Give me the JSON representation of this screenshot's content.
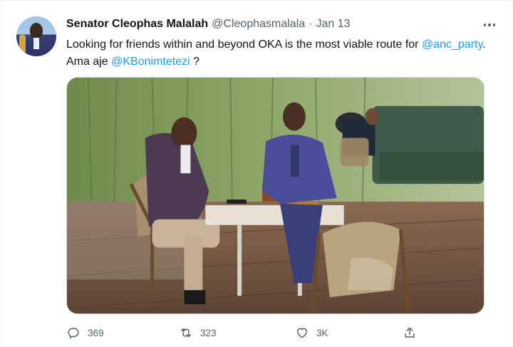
{
  "tweet": {
    "author_name": "Senator Cleophas Malalah",
    "author_handle": "@Cleophasmalala",
    "separator": "·",
    "date": "Jan 13",
    "text_part1": "Looking for friends within and beyond OKA is the most viable route for ",
    "mention1": "@anc_party",
    "text_part2": ". Ama aje ",
    "mention2": "@KBonimtetezi",
    "text_part3": " ?"
  },
  "actions": {
    "replies": "369",
    "retweets": "323",
    "likes": "3K"
  },
  "icons": {
    "reply": "reply-icon",
    "retweet": "retweet-icon",
    "like": "heart-icon",
    "share": "share-icon",
    "more": "more-icon"
  },
  "colors": {
    "link": "#1d9bf0",
    "secondary_text": "#536471",
    "primary_text": "#0f1419"
  }
}
